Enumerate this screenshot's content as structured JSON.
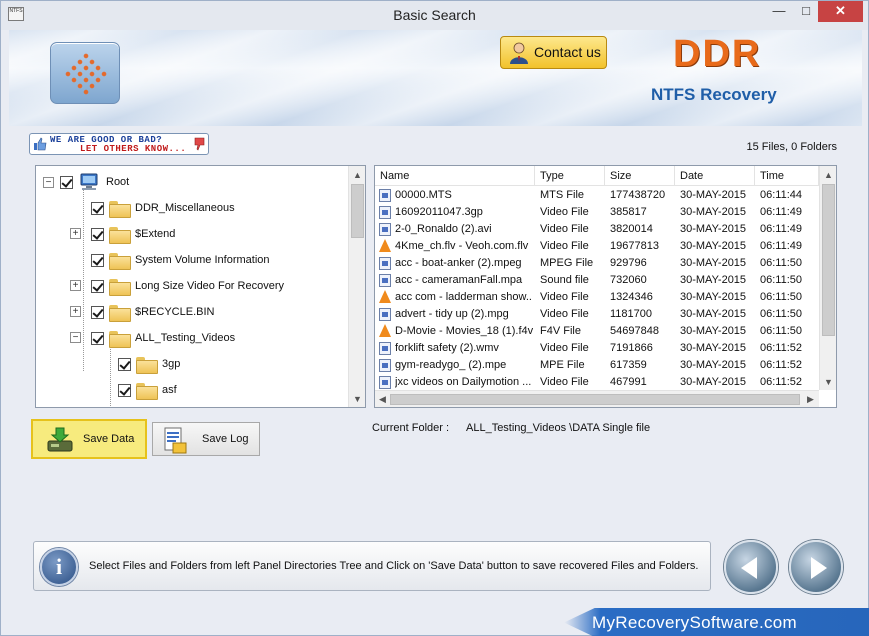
{
  "window": {
    "title": "Basic Search",
    "app_icon_text": "NTFS",
    "min_glyph": "—",
    "max_glyph": "□",
    "close_glyph": "✕"
  },
  "banner": {
    "contact_label": "Contact us",
    "brand": "DDR",
    "product": "NTFS Recovery"
  },
  "feedback": {
    "line1": "WE ARE GOOD OR BAD?",
    "line2": "LET OTHERS KNOW..."
  },
  "summary": "15 Files, 0 Folders",
  "tree": {
    "items": [
      {
        "label": "Root",
        "checked": true
      },
      {
        "label": "DDR_Miscellaneous",
        "checked": true
      },
      {
        "label": "$Extend",
        "checked": true,
        "expander": "+"
      },
      {
        "label": "System Volume Information",
        "checked": true
      },
      {
        "label": "Long Size Video For Recovery",
        "checked": true,
        "expander": "+"
      },
      {
        "label": "$RECYCLE.BIN",
        "checked": true,
        "expander": "+"
      },
      {
        "label": "ALL_Testing_Videos",
        "checked": true,
        "expander": "−"
      },
      {
        "label": "3gp",
        "checked": true
      },
      {
        "label": "asf",
        "checked": true
      }
    ]
  },
  "files": {
    "columns": [
      "Name",
      "Type",
      "Size",
      "Date",
      "Time"
    ],
    "rows": [
      {
        "name": "00000.MTS",
        "type": "MTS File",
        "size": "177438720",
        "date": "30-MAY-2015",
        "time": "06:11:44",
        "icon": "doc"
      },
      {
        "name": "16092011047.3gp",
        "type": "Video File",
        "size": "385817",
        "date": "30-MAY-2015",
        "time": "06:11:49",
        "icon": "doc"
      },
      {
        "name": "2-0_Ronaldo (2).avi",
        "type": "Video File",
        "size": "3820014",
        "date": "30-MAY-2015",
        "time": "06:11:49",
        "icon": "doc"
      },
      {
        "name": "4Kme_ch.flv - Veoh.com.flv",
        "type": "Video File",
        "size": "19677813",
        "date": "30-MAY-2015",
        "time": "06:11:49",
        "icon": "cone"
      },
      {
        "name": "acc - boat-anker (2).mpeg",
        "type": "MPEG File",
        "size": "929796",
        "date": "30-MAY-2015",
        "time": "06:11:50",
        "icon": "doc"
      },
      {
        "name": "acc - cameramanFall.mpa",
        "type": "Sound file",
        "size": "732060",
        "date": "30-MAY-2015",
        "time": "06:11:50",
        "icon": "doc"
      },
      {
        "name": "acc com - ladderman show...",
        "type": "Video File",
        "size": "1324346",
        "date": "30-MAY-2015",
        "time": "06:11:50",
        "icon": "cone"
      },
      {
        "name": "advert - tidy up (2).mpg",
        "type": "Video File",
        "size": "1181700",
        "date": "30-MAY-2015",
        "time": "06:11:50",
        "icon": "doc"
      },
      {
        "name": "D-Movie - Movies_18 (1).f4v",
        "type": "F4V File",
        "size": "54697848",
        "date": "30-MAY-2015",
        "time": "06:11:50",
        "icon": "cone"
      },
      {
        "name": "forklift safety (2).wmv",
        "type": "Video File",
        "size": "7191866",
        "date": "30-MAY-2015",
        "time": "06:11:52",
        "icon": "doc"
      },
      {
        "name": "gym-readygo_ (2).mpe",
        "type": "MPE File",
        "size": "617359",
        "date": "30-MAY-2015",
        "time": "06:11:52",
        "icon": "doc"
      },
      {
        "name": "jxc videos on Dailymotion ...",
        "type": "Video File",
        "size": "467991",
        "date": "30-MAY-2015",
        "time": "06:11:52",
        "icon": "doc"
      }
    ]
  },
  "actions": {
    "save_data": "Save Data",
    "save_log": "Save Log"
  },
  "current_folder": {
    "label": "Current Folder :",
    "value": "ALL_Testing_Videos \\DATA Single file"
  },
  "info": {
    "text": "Select Files and Folders from left Panel Directories Tree and Click on 'Save Data' button to save recovered Files and Folders."
  },
  "footer": {
    "site": "MyRecoverySoftware.com"
  },
  "colors": {
    "brand_orange": "#e86a1a",
    "product_blue": "#1f5ea8",
    "save_highlight": "#f7eb7e"
  }
}
